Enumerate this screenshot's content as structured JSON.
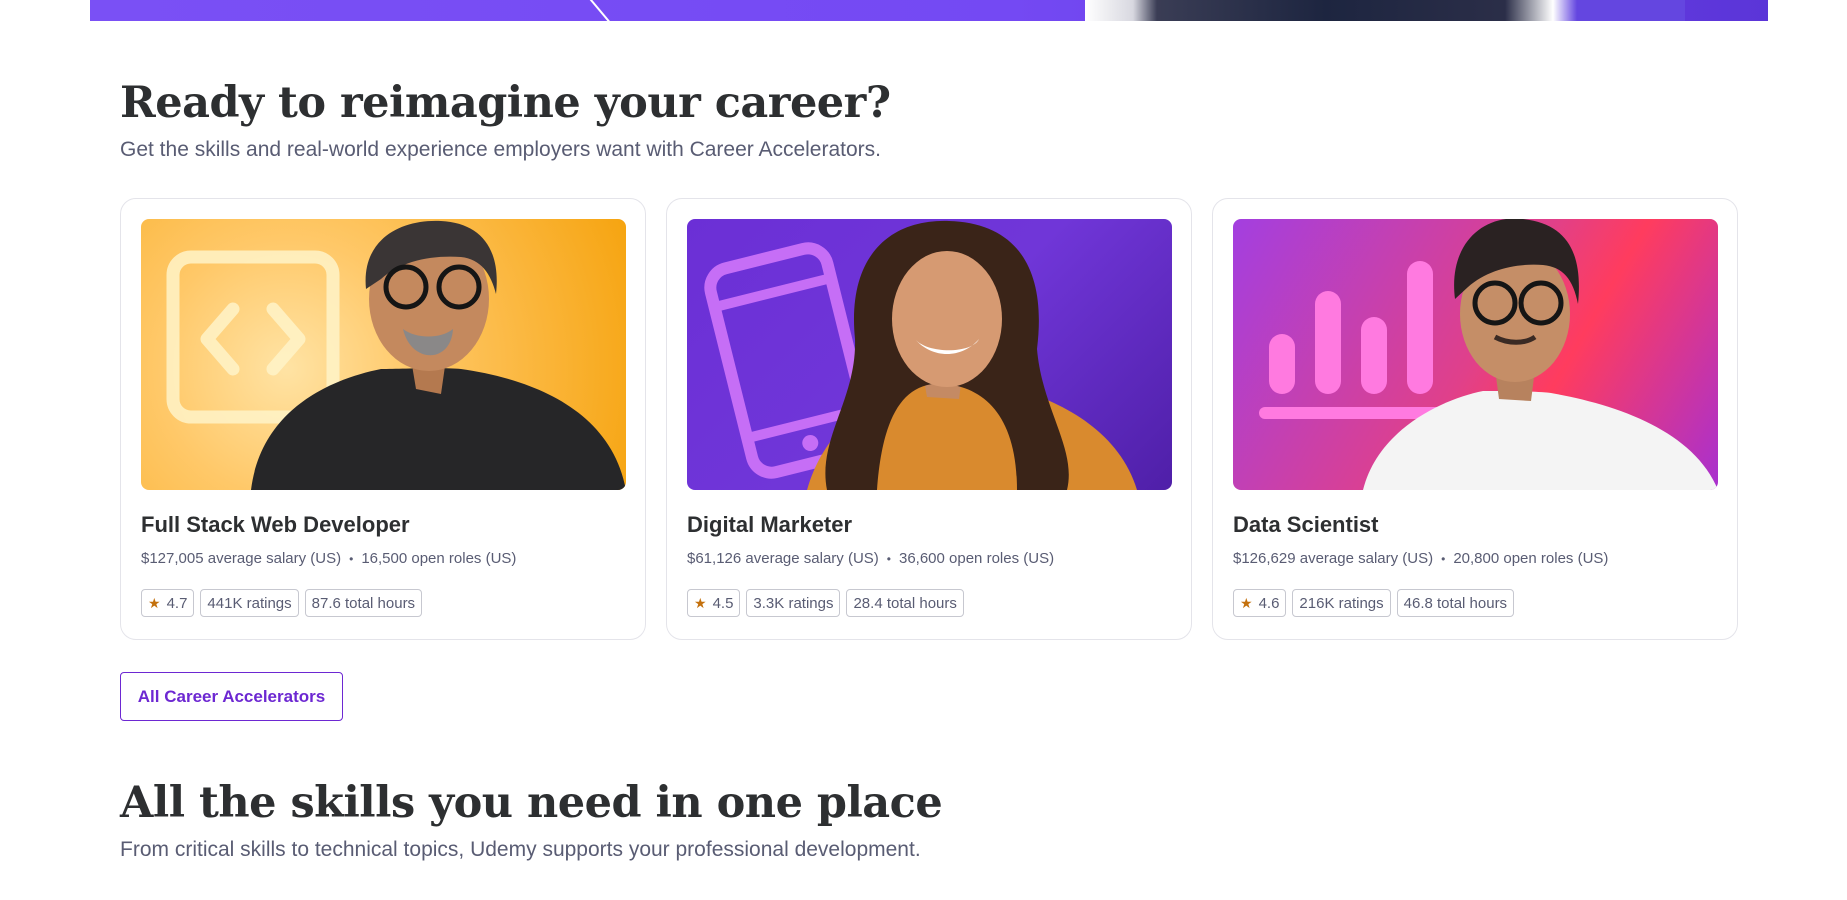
{
  "colors": {
    "brand_purple": "#6d28d2",
    "heading": "#2d2f31",
    "muted": "#595c73",
    "star": "#c4710d"
  },
  "career": {
    "title": "Ready to reimagine your career?",
    "subtitle": "Get the skills and real-world experience employers want with Career Accelerators.",
    "cards": [
      {
        "title": "Full Stack Web Developer",
        "salary": "$127,005 average salary (US)",
        "roles": "16,500 open roles (US)",
        "rating": "4.7",
        "ratings_count": "441K ratings",
        "hours": "87.6 total hours",
        "image_icon": "code-brackets-icon"
      },
      {
        "title": "Digital Marketer",
        "salary": "$61,126 average salary (US)",
        "roles": "36,600 open roles (US)",
        "rating": "4.5",
        "ratings_count": "3.3K ratings",
        "hours": "28.4 total hours",
        "image_icon": "smartphone-icon"
      },
      {
        "title": "Data Scientist",
        "salary": "$126,629 average salary (US)",
        "roles": "20,800 open roles (US)",
        "rating": "4.6",
        "ratings_count": "216K ratings",
        "hours": "46.8 total hours",
        "image_icon": "bar-chart-icon"
      }
    ],
    "all_button": "All Career Accelerators"
  },
  "skills": {
    "title": "All the skills you need in one place",
    "subtitle": "From critical skills to technical topics, Udemy supports your professional development."
  }
}
